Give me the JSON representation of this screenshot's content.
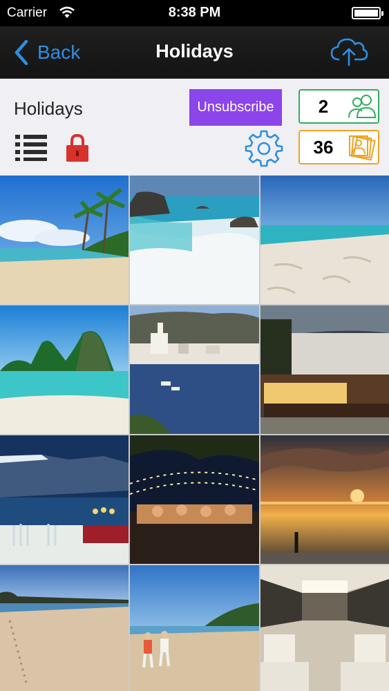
{
  "status_bar": {
    "carrier": "Carrier",
    "time": "8:38 PM"
  },
  "nav": {
    "back_label": "Back",
    "title": "Holidays",
    "upload_icon": "cloud-upload-icon"
  },
  "header": {
    "album_title": "Holidays",
    "unsubscribe_label": "Unsubscribe",
    "subscribers_count": "2",
    "photos_count": "36",
    "icons": [
      "list-icon",
      "lock-icon",
      "gear-icon",
      "people-icon",
      "photos-icon"
    ]
  },
  "colors": {
    "accent_blue": "#2e8fe4",
    "unsubscribe_purple": "#8b45e9",
    "subscribers_green": "#2fae5b",
    "photos_orange": "#eea420",
    "lock_red": "#d9322b"
  },
  "grid": {
    "photos": [
      {
        "subject": "beach-palms"
      },
      {
        "subject": "waves-rocks"
      },
      {
        "subject": "white-sand-beach"
      },
      {
        "subject": "tropical-island"
      },
      {
        "subject": "seaside-village"
      },
      {
        "subject": "night-restaurant"
      },
      {
        "subject": "terrace-dinner"
      },
      {
        "subject": "string-lights-party"
      },
      {
        "subject": "sunset-beach"
      },
      {
        "subject": "footprints-beach"
      },
      {
        "subject": "beach-walkers"
      },
      {
        "subject": "yacht-interior"
      }
    ]
  }
}
